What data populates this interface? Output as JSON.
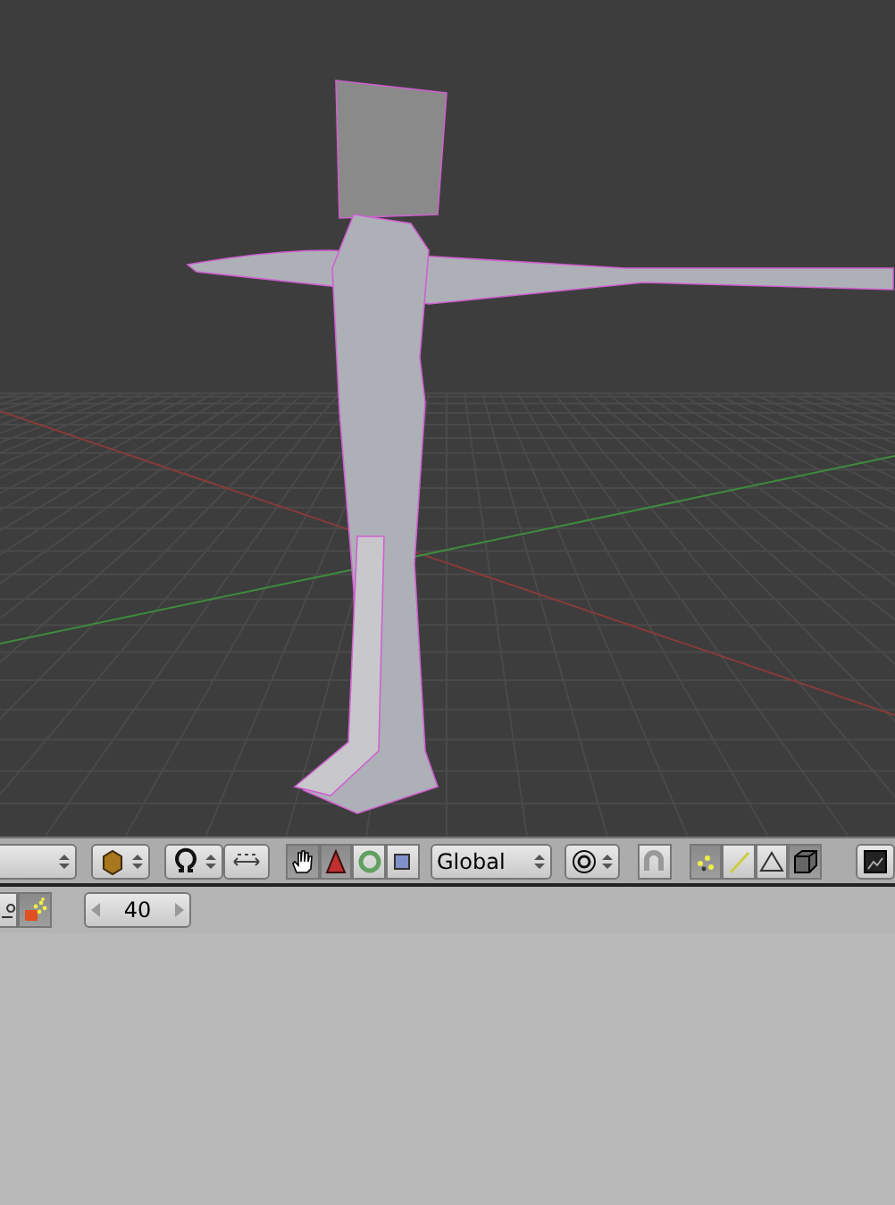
{
  "header": {
    "items": [
      {
        "kind": "menu"
      },
      {
        "kind": "shading-menu"
      },
      {
        "kind": "pivot-menu"
      },
      {
        "kind": "axis-toggle"
      },
      {
        "kind": "hand",
        "selected": true
      },
      {
        "kind": "translate",
        "selected": true
      },
      {
        "kind": "rotate",
        "selected": false
      },
      {
        "kind": "scale",
        "selected": false
      },
      {
        "kind": "orientation",
        "label": "Global"
      },
      {
        "kind": "proportional-menu"
      },
      {
        "kind": "snap",
        "selected": false
      },
      {
        "kind": "vertex",
        "selected": true
      },
      {
        "kind": "edge",
        "selected": false
      },
      {
        "kind": "face",
        "selected": false
      },
      {
        "kind": "occlude",
        "selected": true
      },
      {
        "kind": "render"
      }
    ]
  },
  "timeline": {
    "particles": {
      "selected": true
    },
    "frame": "40"
  }
}
